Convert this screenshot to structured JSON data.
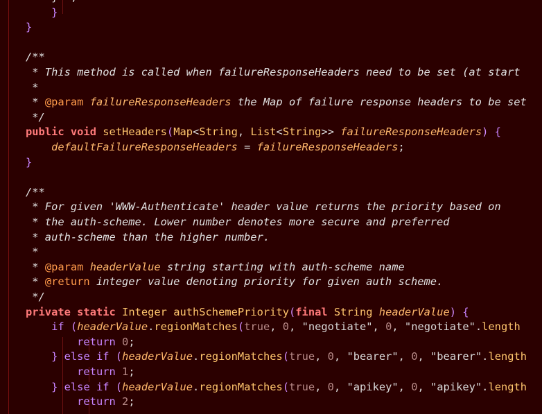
{
  "theme": {
    "background": "#2b0000",
    "gutter": "#7a1010",
    "guide": "#6e1212"
  },
  "lines": [
    [
      [
        "punct",
        "    }  ;"
      ]
    ],
    [
      [
        "brace",
        "    }"
      ]
    ],
    [
      [
        "brace",
        "}"
      ]
    ],
    [
      [
        "plain",
        ""
      ]
    ],
    [
      [
        "comment",
        "/**"
      ]
    ],
    [
      [
        "comment",
        " * This method is called when failureResponseHeaders need to be set (at start"
      ]
    ],
    [
      [
        "comment",
        " *"
      ]
    ],
    [
      [
        "comment",
        " * "
      ],
      [
        "annot",
        "@param"
      ],
      [
        "comment",
        " "
      ],
      [
        "param",
        "failureResponseHeaders"
      ],
      [
        "comment",
        " the Map of failure response headers to be set"
      ]
    ],
    [
      [
        "comment",
        " */"
      ]
    ],
    [
      [
        "kw",
        "public"
      ],
      [
        "plain",
        " "
      ],
      [
        "kw",
        "void"
      ],
      [
        "plain",
        " "
      ],
      [
        "method",
        "setHeaders"
      ],
      [
        "paren",
        "("
      ],
      [
        "type",
        "Map"
      ],
      [
        "punct",
        "<"
      ],
      [
        "type",
        "String"
      ],
      [
        "punct",
        ", "
      ],
      [
        "type",
        "List"
      ],
      [
        "punct",
        "<"
      ],
      [
        "type",
        "String"
      ],
      [
        "punct",
        ">> "
      ],
      [
        "param",
        "failureResponseHeaders"
      ],
      [
        "paren",
        ")"
      ],
      [
        "plain",
        " "
      ],
      [
        "brace",
        "{"
      ]
    ],
    [
      [
        "plain",
        "    "
      ],
      [
        "param",
        "defaultFailureResponseHeaders"
      ],
      [
        "plain",
        " = "
      ],
      [
        "param",
        "failureResponseHeaders"
      ],
      [
        "punct",
        ";"
      ]
    ],
    [
      [
        "brace",
        "}"
      ]
    ],
    [
      [
        "plain",
        ""
      ]
    ],
    [
      [
        "comment",
        "/**"
      ]
    ],
    [
      [
        "comment",
        " * For given 'WWW-Authenticate' header value returns the priority based on"
      ]
    ],
    [
      [
        "comment",
        " * the auth-scheme. Lower number denotes more secure and preferred"
      ]
    ],
    [
      [
        "comment",
        " * auth-scheme than the higher number."
      ]
    ],
    [
      [
        "comment",
        " *"
      ]
    ],
    [
      [
        "comment",
        " * "
      ],
      [
        "annot",
        "@param"
      ],
      [
        "comment",
        " "
      ],
      [
        "param",
        "headerValue"
      ],
      [
        "comment",
        " string starting with auth-scheme name"
      ]
    ],
    [
      [
        "comment",
        " * "
      ],
      [
        "annot",
        "@return"
      ],
      [
        "comment",
        " integer value denoting priority for given auth scheme."
      ]
    ],
    [
      [
        "comment",
        " */"
      ]
    ],
    [
      [
        "kw",
        "private"
      ],
      [
        "plain",
        " "
      ],
      [
        "kw",
        "static"
      ],
      [
        "plain",
        " "
      ],
      [
        "type",
        "Integer"
      ],
      [
        "plain",
        " "
      ],
      [
        "method",
        "authSchemePriority"
      ],
      [
        "paren",
        "("
      ],
      [
        "kw",
        "final"
      ],
      [
        "plain",
        " "
      ],
      [
        "type",
        "String"
      ],
      [
        "plain",
        " "
      ],
      [
        "param",
        "headerValue"
      ],
      [
        "paren",
        ")"
      ],
      [
        "plain",
        " "
      ],
      [
        "brace",
        "{"
      ]
    ],
    [
      [
        "plain",
        "    "
      ],
      [
        "kw2",
        "if"
      ],
      [
        "plain",
        " "
      ],
      [
        "paren",
        "("
      ],
      [
        "param",
        "headerValue"
      ],
      [
        "punct",
        "."
      ],
      [
        "method",
        "regionMatches"
      ],
      [
        "paren",
        "("
      ],
      [
        "num",
        "true"
      ],
      [
        "punct",
        ", "
      ],
      [
        "num",
        "0"
      ],
      [
        "punct",
        ", "
      ],
      [
        "str",
        "\"negotiate\""
      ],
      [
        "punct",
        ", "
      ],
      [
        "num",
        "0"
      ],
      [
        "punct",
        ", "
      ],
      [
        "str",
        "\"negotiate\""
      ],
      [
        "punct",
        "."
      ],
      [
        "method",
        "length"
      ]
    ],
    [
      [
        "plain",
        "        "
      ],
      [
        "kw2",
        "return"
      ],
      [
        "plain",
        " "
      ],
      [
        "num",
        "0"
      ],
      [
        "punct",
        ";"
      ]
    ],
    [
      [
        "plain",
        "    "
      ],
      [
        "brace",
        "}"
      ],
      [
        "plain",
        " "
      ],
      [
        "kw2",
        "else if"
      ],
      [
        "plain",
        " "
      ],
      [
        "paren",
        "("
      ],
      [
        "param",
        "headerValue"
      ],
      [
        "punct",
        "."
      ],
      [
        "method",
        "regionMatches"
      ],
      [
        "paren",
        "("
      ],
      [
        "num",
        "true"
      ],
      [
        "punct",
        ", "
      ],
      [
        "num",
        "0"
      ],
      [
        "punct",
        ", "
      ],
      [
        "str",
        "\"bearer\""
      ],
      [
        "punct",
        ", "
      ],
      [
        "num",
        "0"
      ],
      [
        "punct",
        ", "
      ],
      [
        "str",
        "\"bearer\""
      ],
      [
        "punct",
        "."
      ],
      [
        "method",
        "length"
      ]
    ],
    [
      [
        "plain",
        "        "
      ],
      [
        "kw2",
        "return"
      ],
      [
        "plain",
        " "
      ],
      [
        "num",
        "1"
      ],
      [
        "punct",
        ";"
      ]
    ],
    [
      [
        "plain",
        "    "
      ],
      [
        "brace",
        "}"
      ],
      [
        "plain",
        " "
      ],
      [
        "kw2",
        "else if"
      ],
      [
        "plain",
        " "
      ],
      [
        "paren",
        "("
      ],
      [
        "param",
        "headerValue"
      ],
      [
        "punct",
        "."
      ],
      [
        "method",
        "regionMatches"
      ],
      [
        "paren",
        "("
      ],
      [
        "num",
        "true"
      ],
      [
        "punct",
        ", "
      ],
      [
        "num",
        "0"
      ],
      [
        "punct",
        ", "
      ],
      [
        "str",
        "\"apikey\""
      ],
      [
        "punct",
        ", "
      ],
      [
        "num",
        "0"
      ],
      [
        "punct",
        ", "
      ],
      [
        "str",
        "\"apikey\""
      ],
      [
        "punct",
        "."
      ],
      [
        "method",
        "length"
      ]
    ],
    [
      [
        "plain",
        "        "
      ],
      [
        "kw2",
        "return"
      ],
      [
        "plain",
        " "
      ],
      [
        "num",
        "2"
      ],
      [
        "punct",
        ";"
      ]
    ]
  ]
}
